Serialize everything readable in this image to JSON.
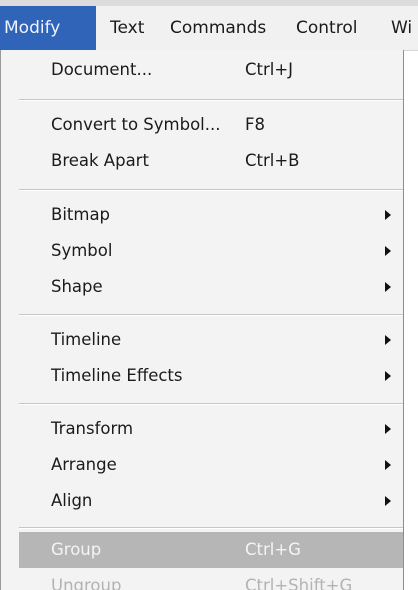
{
  "menubar": {
    "modify": "Modify",
    "text": "Text",
    "commands": "Commands",
    "control": "Control",
    "window_partial": "Wi"
  },
  "menu": {
    "document": {
      "label": "Document...",
      "shortcut": "Ctrl+J"
    },
    "convert_to_symbol": {
      "label": "Convert to Symbol...",
      "shortcut": "F8"
    },
    "break_apart": {
      "label": "Break Apart",
      "shortcut": "Ctrl+B"
    },
    "bitmap": {
      "label": "Bitmap"
    },
    "symbol": {
      "label": "Symbol"
    },
    "shape": {
      "label": "Shape"
    },
    "timeline": {
      "label": "Timeline"
    },
    "timeline_effects": {
      "label": "Timeline Effects"
    },
    "transform": {
      "label": "Transform"
    },
    "arrange": {
      "label": "Arrange"
    },
    "align": {
      "label": "Align"
    },
    "group": {
      "label": "Group",
      "shortcut": "Ctrl+G"
    },
    "ungroup": {
      "label": "Ungroup",
      "shortcut": "Ctrl+Shift+G"
    }
  },
  "colors": {
    "menubar_active": "#2f64b8",
    "highlight": "#b6b6b6",
    "disabled_text": "#b3b3b3",
    "menu_background": "#f3f3f3"
  },
  "icons": {
    "submenu": "submenu-arrow-icon"
  }
}
